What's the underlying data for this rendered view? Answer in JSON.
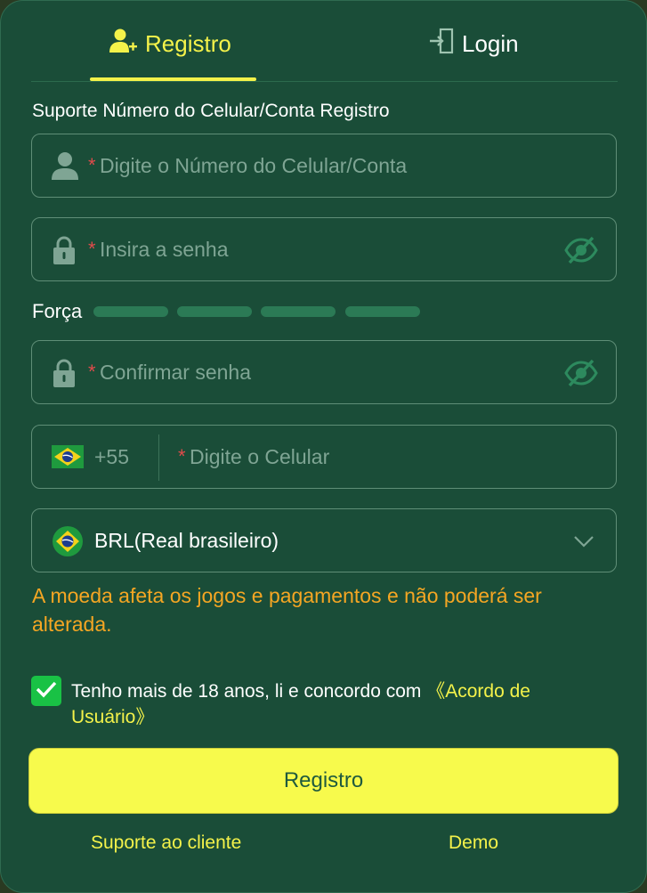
{
  "tabs": {
    "register": "Registro",
    "login": "Login"
  },
  "form": {
    "support_label": "Suporte Número do Celular/Conta Registro",
    "required_mark": "*",
    "account_placeholder": "Digite o Número do Celular/Conta",
    "password_placeholder": "Insira a senha",
    "strength_label": "Força",
    "confirm_placeholder": "Confirmar senha",
    "phone_code": "+55",
    "phone_placeholder": "Digite o Celular",
    "currency_value": "BRL(Real brasileiro)",
    "currency_warning": "A moeda afeta os jogos e pagamentos e não poderá ser alterada.",
    "agreement_text": "Tenho mais de 18 anos, li e concordo com ",
    "agreement_link": "《Acordo de Usuário》",
    "agreement_checked": true,
    "submit_label": "Registro"
  },
  "footer": {
    "support": "Suporte ao cliente",
    "demo": "Demo"
  },
  "icons": [
    "user-plus-icon",
    "login-door-icon",
    "user-icon",
    "lock-icon",
    "eye-off-icon",
    "brazil-flag-icon",
    "chevron-down-icon",
    "check-icon"
  ],
  "colors": {
    "background": "#1a4d38",
    "accent": "#f4f24a",
    "required": "#e04b4b",
    "warning": "#f5a623",
    "checkbox": "#19c245",
    "button": "#f7fa4c"
  }
}
